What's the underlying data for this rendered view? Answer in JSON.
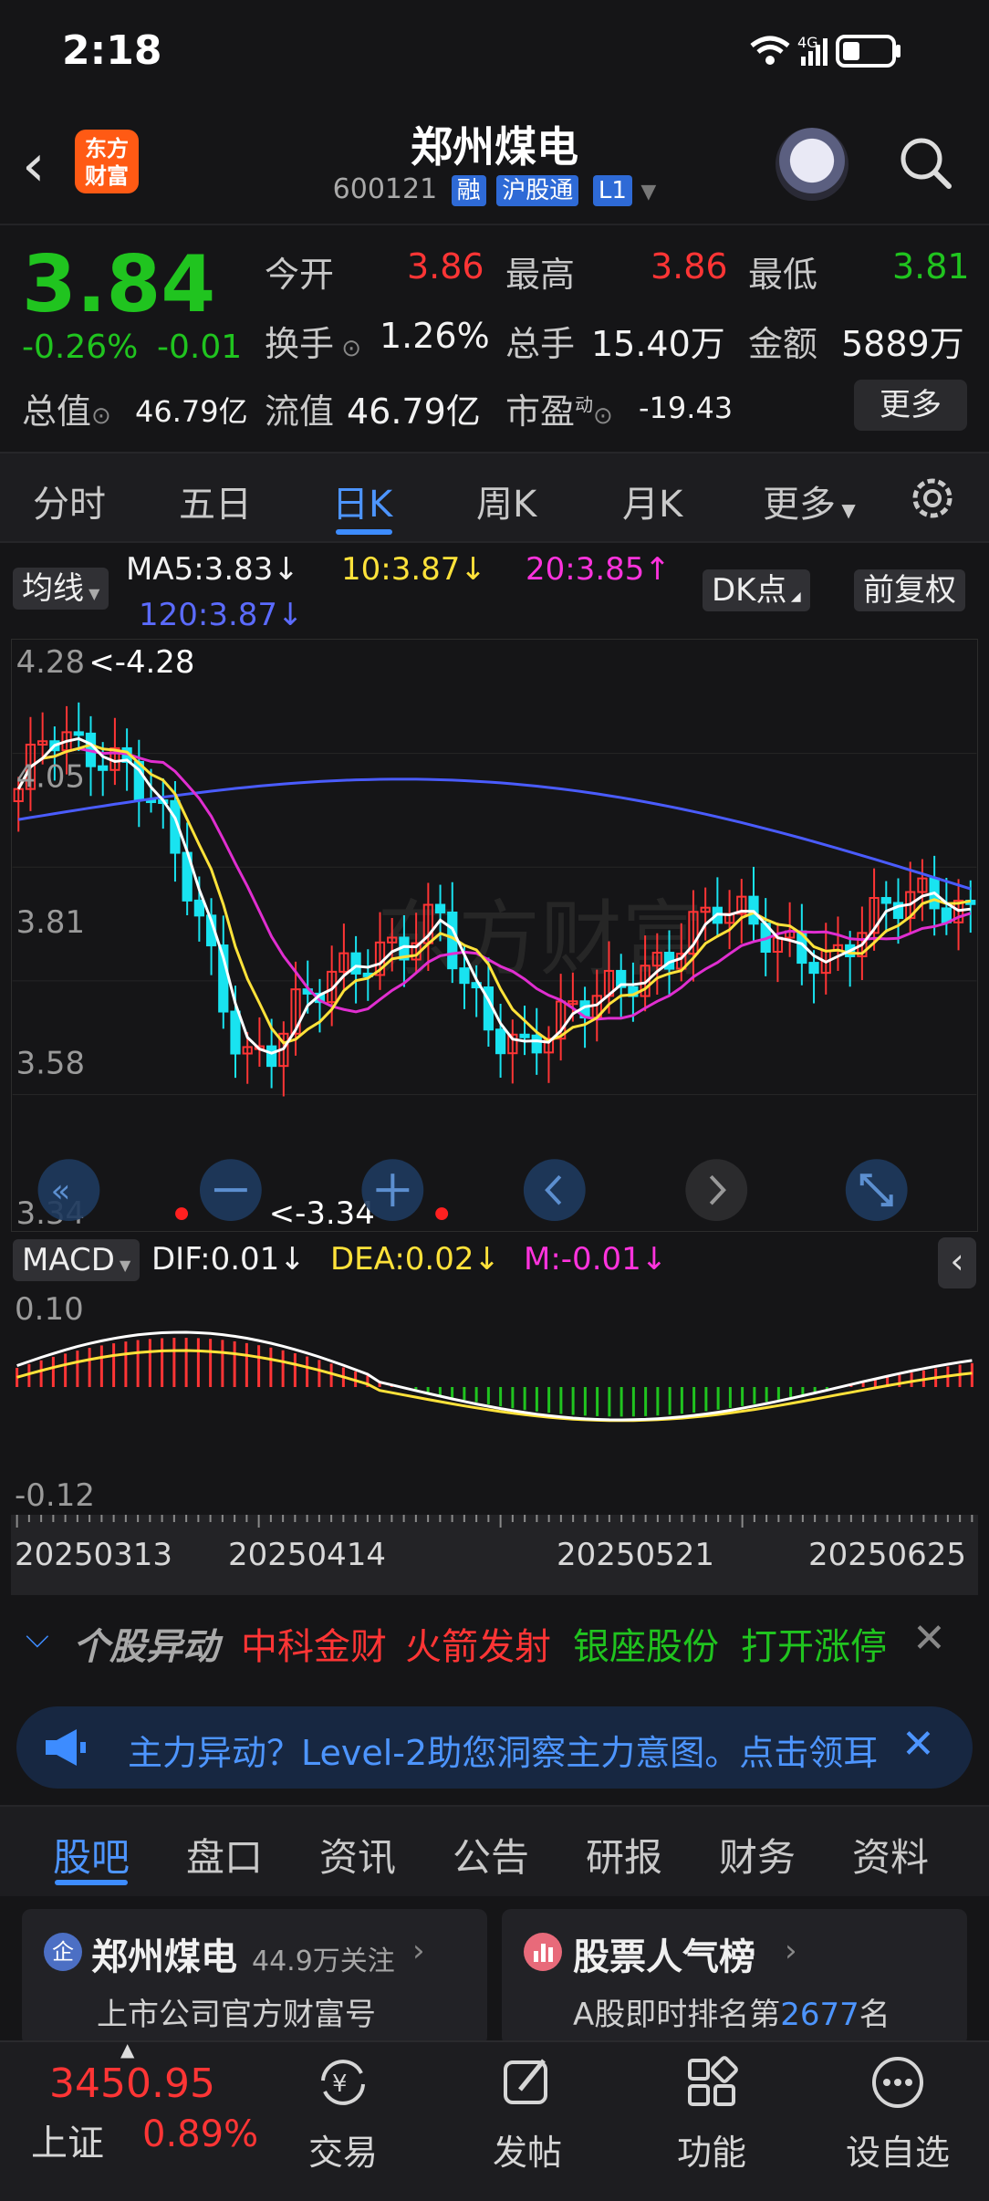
{
  "status_bar": {
    "time": "2:18"
  },
  "header": {
    "logo_line1": "东方",
    "logo_line2": "财富",
    "stock_name": "郑州煤电",
    "stock_code": "600121",
    "tag_rong": "融",
    "tag_hgt": "沪股通",
    "tag_l1": "L1"
  },
  "quote": {
    "price": "3.84",
    "change_pct": "-0.26%",
    "change": "-0.01",
    "open_label": "今开",
    "open": "3.86",
    "high_label": "最高",
    "high": "3.86",
    "low_label": "最低",
    "low": "3.81",
    "turnover_label": "换手",
    "turnover": "1.26%",
    "volume_label": "总手",
    "volume": "15.40万",
    "amount_label": "金额",
    "amount": "5889万",
    "total_cap_label": "总值",
    "total_cap": "46.79亿",
    "float_cap_label": "流值",
    "float_cap": "46.79亿",
    "pe_label": "市盈",
    "pe_sup": "动",
    "pe": "-19.43",
    "more_label": "更多"
  },
  "period_tabs": [
    "分时",
    "五日",
    "日K",
    "周K",
    "月K",
    "更多"
  ],
  "active_period": "日K",
  "ma": {
    "toggle_label": "均线",
    "ma5": "MA5:3.83↓",
    "ma10": "10:3.87↓",
    "ma20": "20:3.85↑",
    "ma120": "120:3.87↓",
    "dk_label": "DK点",
    "adjust_label": "前复权"
  },
  "kchart": {
    "price_labels": [
      "4.28",
      "4.05",
      "3.81",
      "3.58",
      "3.34"
    ],
    "max_marker": "<-4.28",
    "min_marker": "<-3.34",
    "watermark": "东方财富"
  },
  "macd": {
    "selector_label": "MACD",
    "dif": "DIF:0.01↓",
    "dea": "DEA:0.02↓",
    "m": "M:-0.01↓",
    "top_label": "0.10",
    "bottom_label": "-0.12"
  },
  "dates": [
    "20250313",
    "20250414",
    "20250521",
    "20250625"
  ],
  "movement": {
    "title": "个股异动",
    "item1": "中科金财",
    "item2": "火箭发射",
    "item3": "银座股份",
    "item4": "打开涨停"
  },
  "ad": {
    "text": "主力异动？Level-2助您洞察主力意图。点击领耳"
  },
  "sub_tabs": [
    "股吧",
    "盘口",
    "资讯",
    "公告",
    "研报",
    "财务",
    "资料"
  ],
  "active_sub_tab": "股吧",
  "cards": {
    "left_title": "郑州煤电",
    "left_follow": "44.9万关注",
    "left_sub": "上市公司官方财富号",
    "right_title": "股票人气榜",
    "right_sub_prefix": "A股即时排名第",
    "right_rank": "2677",
    "right_sub_suffix": "名"
  },
  "bottom_bar": {
    "index_value": "3450.95",
    "index_name": "上证",
    "index_change": "0.89%",
    "nav": [
      "交易",
      "发帖",
      "功能",
      "设自选"
    ]
  },
  "colors": {
    "up": "#ff3535",
    "down": "#20c41f",
    "accent": "#3d8cff",
    "ma5": "#ffffff",
    "ma10": "#ffe23a",
    "ma20": "#ff33dd",
    "ma120": "#5b6bff",
    "candle_down": "#19e3f0"
  }
}
